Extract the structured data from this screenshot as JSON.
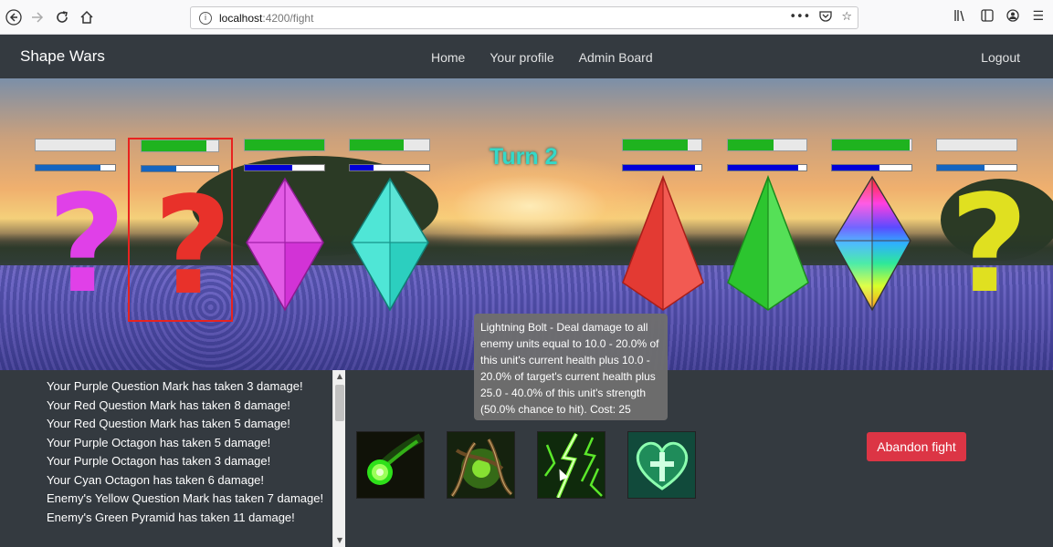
{
  "browser": {
    "url_host": "localhost",
    "url_path": ":4200/fight",
    "back_icon": "back-arrow-icon",
    "forward_icon": "forward-arrow-icon",
    "reload_icon": "reload-icon",
    "home_icon": "home-icon",
    "more_glyph": "•••"
  },
  "navbar": {
    "brand": "Shape Wars",
    "links": [
      "Home",
      "Your profile",
      "Admin Board"
    ],
    "logout": "Logout"
  },
  "battle": {
    "turn_label": "Turn 2",
    "player_units": [
      {
        "name": "Purple Question Mark",
        "shape": "question-mark",
        "color": "#e040e8",
        "health": 0.0,
        "mana": 0.82
      },
      {
        "name": "Red Question Mark",
        "shape": "question-mark",
        "color": "#e8312a",
        "health": 0.85,
        "mana": 0.45,
        "selected": true
      },
      {
        "name": "Purple Octagon",
        "shape": "octagon",
        "color": "#e040e8",
        "health": 1.0,
        "mana": 0.6
      },
      {
        "name": "Cyan Octagon",
        "shape": "octagon",
        "color": "#33e0d0",
        "health": 0.68,
        "mana": 0.3
      }
    ],
    "enemy_units": [
      {
        "name": "Red Pyramid",
        "shape": "pyramid",
        "color": "#e8312a",
        "health": 0.83,
        "mana": 0.92
      },
      {
        "name": "Green Pyramid",
        "shape": "pyramid",
        "color": "#38d83a",
        "health": 0.58,
        "mana": 0.9
      },
      {
        "name": "Rainbow Octagon",
        "shape": "octagon",
        "color": "rainbow",
        "health": 0.98,
        "mana": 0.6
      },
      {
        "name": "Yellow Question Mark",
        "shape": "question-mark",
        "color": "#e0e020",
        "health": 0.0,
        "mana": 0.6
      }
    ]
  },
  "tooltip": {
    "text": "Lightning Bolt - Deal damage to all enemy units equal to 10.0 - 20.0% of this unit's current health plus 10.0 - 20.0% of target's current health plus 25.0 - 40.0% of this unit's strength (50.0% chance to hit). Cost: 25"
  },
  "log": [
    "Your Purple Question Mark has taken 3 damage!",
    "Your Red Question Mark has taken 8 damage!",
    "Your Red Question Mark has taken 5 damage!",
    "Your Purple Octagon has taken 5 damage!",
    "Your Purple Octagon has taken 3 damage!",
    "Your Cyan Octagon has taken 6 damage!",
    "Enemy's Yellow Question Mark has taken 7 damage!",
    "Enemy's Green Pyramid has taken 11 damage!"
  ],
  "skills": [
    {
      "icon": "fireball-skill-icon"
    },
    {
      "icon": "thorny-vines-skill-icon"
    },
    {
      "icon": "lightning-bolt-skill-icon"
    },
    {
      "icon": "heart-heal-skill-icon"
    }
  ],
  "abandon_label": "Abandon fight"
}
